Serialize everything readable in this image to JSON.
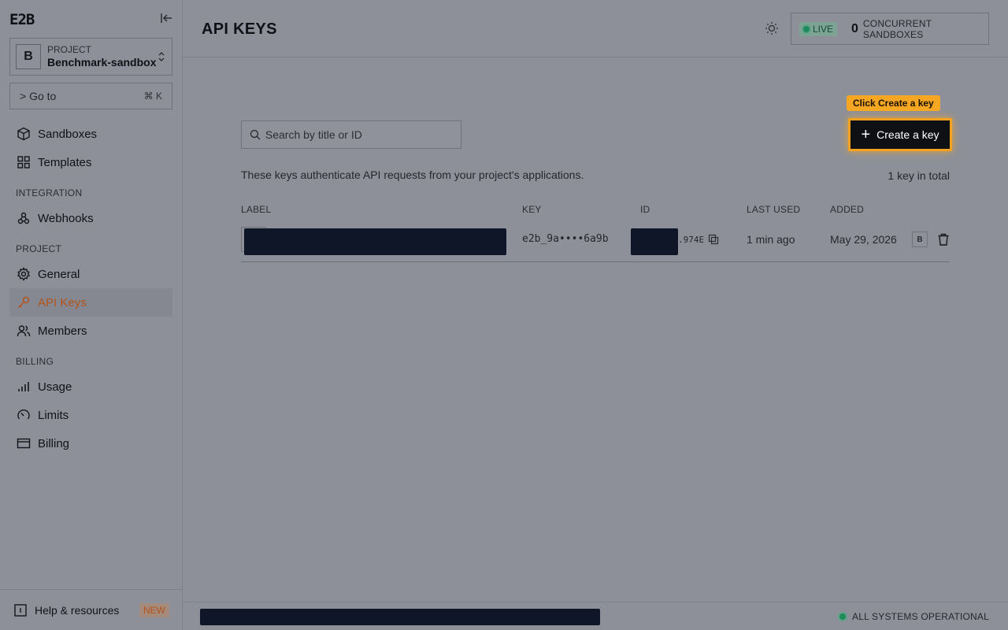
{
  "brand": {
    "logo_text": "E2B"
  },
  "project": {
    "avatar_letter": "B",
    "caption": "PROJECT",
    "name": "Benchmark-sandbox"
  },
  "goto": {
    "label": "> Go to",
    "shortcut": "⌘ K"
  },
  "sidebar": {
    "items": [
      {
        "label": "Sandboxes",
        "icon": "cube-icon"
      },
      {
        "label": "Templates",
        "icon": "grid-icon"
      },
      {
        "label": "Webhooks",
        "icon": "webhook-icon"
      },
      {
        "label": "General",
        "icon": "gear-icon"
      },
      {
        "label": "API Keys",
        "icon": "key-icon",
        "active": true
      },
      {
        "label": "Members",
        "icon": "users-icon"
      },
      {
        "label": "Usage",
        "icon": "bar-chart-icon"
      },
      {
        "label": "Limits",
        "icon": "gauge-icon"
      },
      {
        "label": "Billing",
        "icon": "card-icon"
      }
    ],
    "sections": {
      "integration": "INTEGRATION",
      "project": "PROJECT",
      "billing": "BILLING"
    },
    "help": {
      "label": "Help & resources",
      "badge": "NEW"
    }
  },
  "header": {
    "title": "API KEYS",
    "live_label": "LIVE",
    "concurrent_count": "0",
    "concurrent_label": "CONCURRENT SANDBOXES"
  },
  "main": {
    "search_placeholder": "Search by title or ID",
    "tooltip": "Click Create a key",
    "create_button": "Create a key",
    "description": "These keys authenticate API requests from your project's applications.",
    "total": "1 key in total",
    "columns": [
      "LABEL",
      "KEY",
      "ID",
      "LAST USED",
      "ADDED"
    ],
    "rows": [
      {
        "key_mask": "e2b_9a••••6a9b",
        "id_suffix": ".974E",
        "last_used": "1 min ago",
        "added": "May 29, 2026",
        "creator": "B"
      }
    ]
  },
  "footer": {
    "status": "ALL SYSTEMS OPERATIONAL"
  },
  "colors": {
    "accent": "#b2541a",
    "highlight": "#f5a623",
    "live": "#1f8a5c",
    "redaction": "#0f1627"
  }
}
